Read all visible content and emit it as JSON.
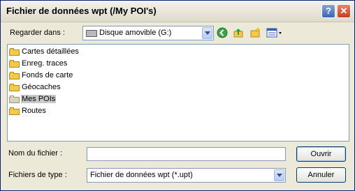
{
  "window": {
    "title": "Fichier de données wpt (/My POI's)",
    "help_label": "?",
    "close_label": "✕"
  },
  "lookin": {
    "label": "Regarder dans :",
    "value": "Disque amovible (G:)"
  },
  "toolbar": {
    "back_icon": "back-icon",
    "up_icon": "up-folder-icon",
    "new_folder_icon": "new-folder-icon",
    "views_icon": "views-menu-icon"
  },
  "files": [
    {
      "name": "Cartes détaillées",
      "selected": false
    },
    {
      "name": "Enreg. traces",
      "selected": false
    },
    {
      "name": "Fonds de carte",
      "selected": false
    },
    {
      "name": "Géocaches",
      "selected": false
    },
    {
      "name": "Mes POIs",
      "selected": true
    },
    {
      "name": "Routes",
      "selected": false
    }
  ],
  "filename": {
    "label": "Nom du fichier :",
    "value": ""
  },
  "filetype": {
    "label": "Fichiers de type :",
    "value": "Fichier de données wpt (*.upt)"
  },
  "buttons": {
    "open": "Ouvrir",
    "cancel": "Annuler"
  },
  "colors": {
    "titlebar_border": "#0a246a",
    "dialog_bg": "#ece9d8",
    "field_border": "#7f9db9",
    "selection": "#c8c8c8"
  }
}
